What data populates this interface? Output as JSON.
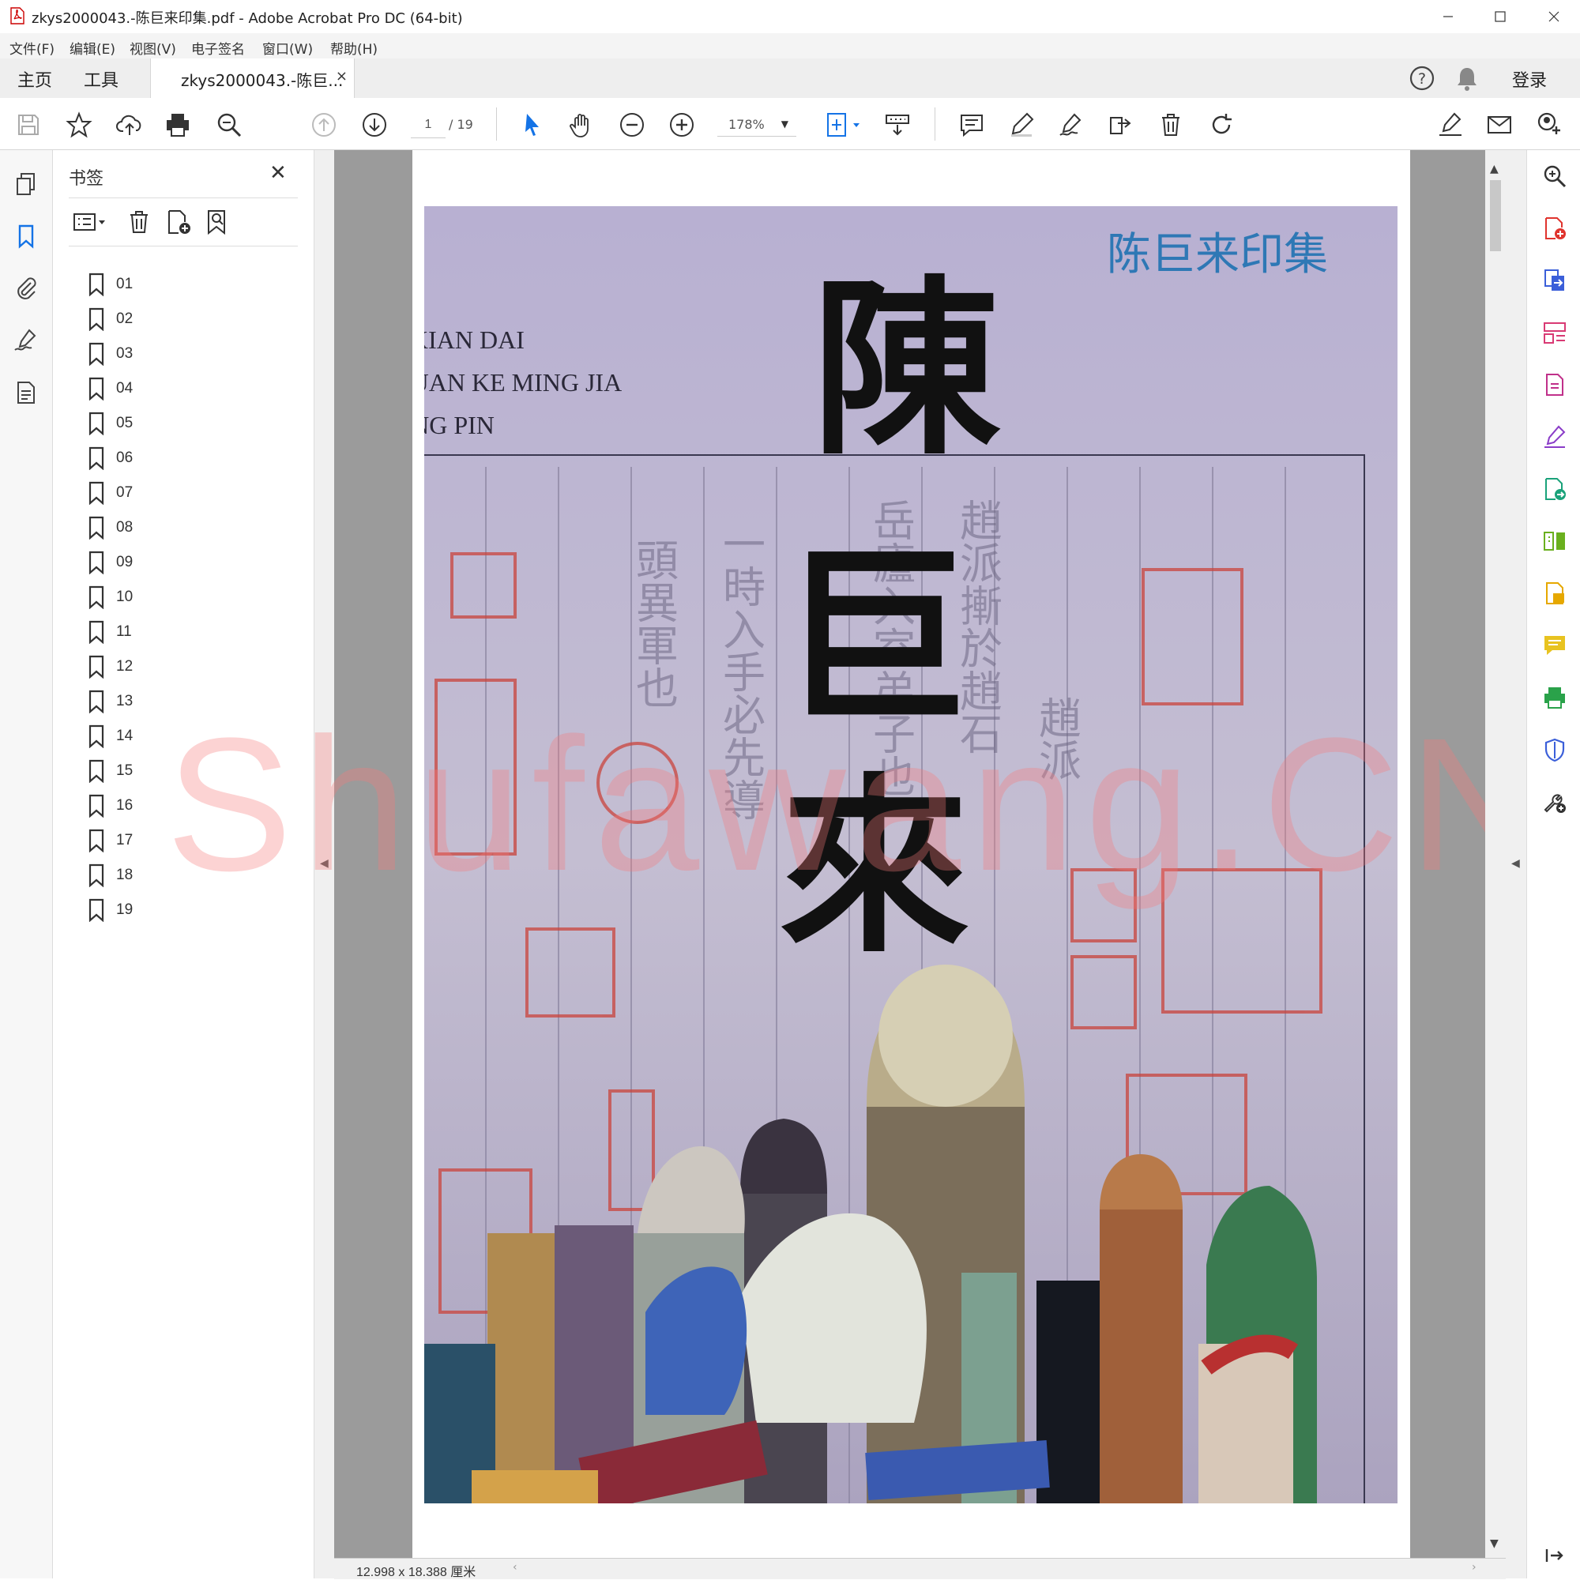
{
  "window": {
    "title": "zkys2000043.-陈巨来印集.pdf - Adobe Acrobat Pro DC (64-bit)",
    "minimize": "—",
    "maximize": "☐",
    "close": "✕"
  },
  "menu": [
    "文件(F)",
    "编辑(E)",
    "视图(V)",
    "电子签名",
    "窗口(W)",
    "帮助(H)"
  ],
  "tabs": {
    "home": "主页",
    "tools": "工具",
    "document": "zkys2000043.-陈巨...",
    "close": "×",
    "signin": "登录"
  },
  "toolbar": {
    "page_current": "1",
    "page_total": "/ 19",
    "zoom": "178%"
  },
  "bookmarks": {
    "title": "书签",
    "close": "✕",
    "items": [
      "01",
      "02",
      "03",
      "04",
      "05",
      "06",
      "07",
      "08",
      "09",
      "10",
      "11",
      "12",
      "13",
      "14",
      "15",
      "16",
      "17",
      "18",
      "19"
    ]
  },
  "cover": {
    "series_title": "陈巨来印集",
    "pinyin_line1": "XIAN DAI",
    "pinyin_line2": "ZHUAN KE   MING JIA",
    "pinyin_line3": "JING PIN",
    "calligraphy": [
      "陳",
      "巨",
      "來"
    ]
  },
  "watermark": "Shufawang.CN",
  "status": {
    "page_size": "12.998 x 18.388 厘米"
  },
  "colors": {
    "accent_blue": "#1473e6",
    "cover_bg": "#b9b1cc",
    "seal_red": "#c9443c",
    "title_blue": "#2e78b5"
  }
}
